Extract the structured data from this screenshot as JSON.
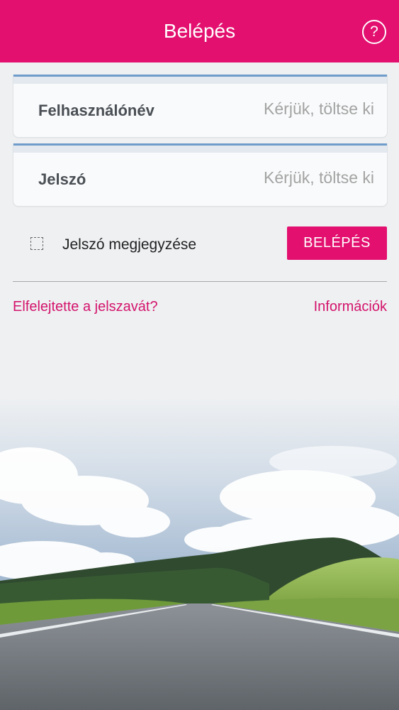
{
  "header": {
    "title": "Belépés",
    "help_icon": "question-circle-icon",
    "help_symbol": "?"
  },
  "form": {
    "username": {
      "label": "Felhasználónév",
      "placeholder": "Kérjük, töltse ki",
      "value": ""
    },
    "password": {
      "label": "Jelszó",
      "placeholder": "Kérjük, töltse ki",
      "value": ""
    },
    "remember": {
      "label": "Jelszó megjegyzése",
      "checked": false
    },
    "submit_label": "BELÉPÉS"
  },
  "links": {
    "forgot": "Elfelejtette a jelszavát?",
    "info": "Információk"
  },
  "colors": {
    "brand": "#e3106f",
    "field_accent": "#6f9cc9",
    "link": "#d4146c"
  }
}
